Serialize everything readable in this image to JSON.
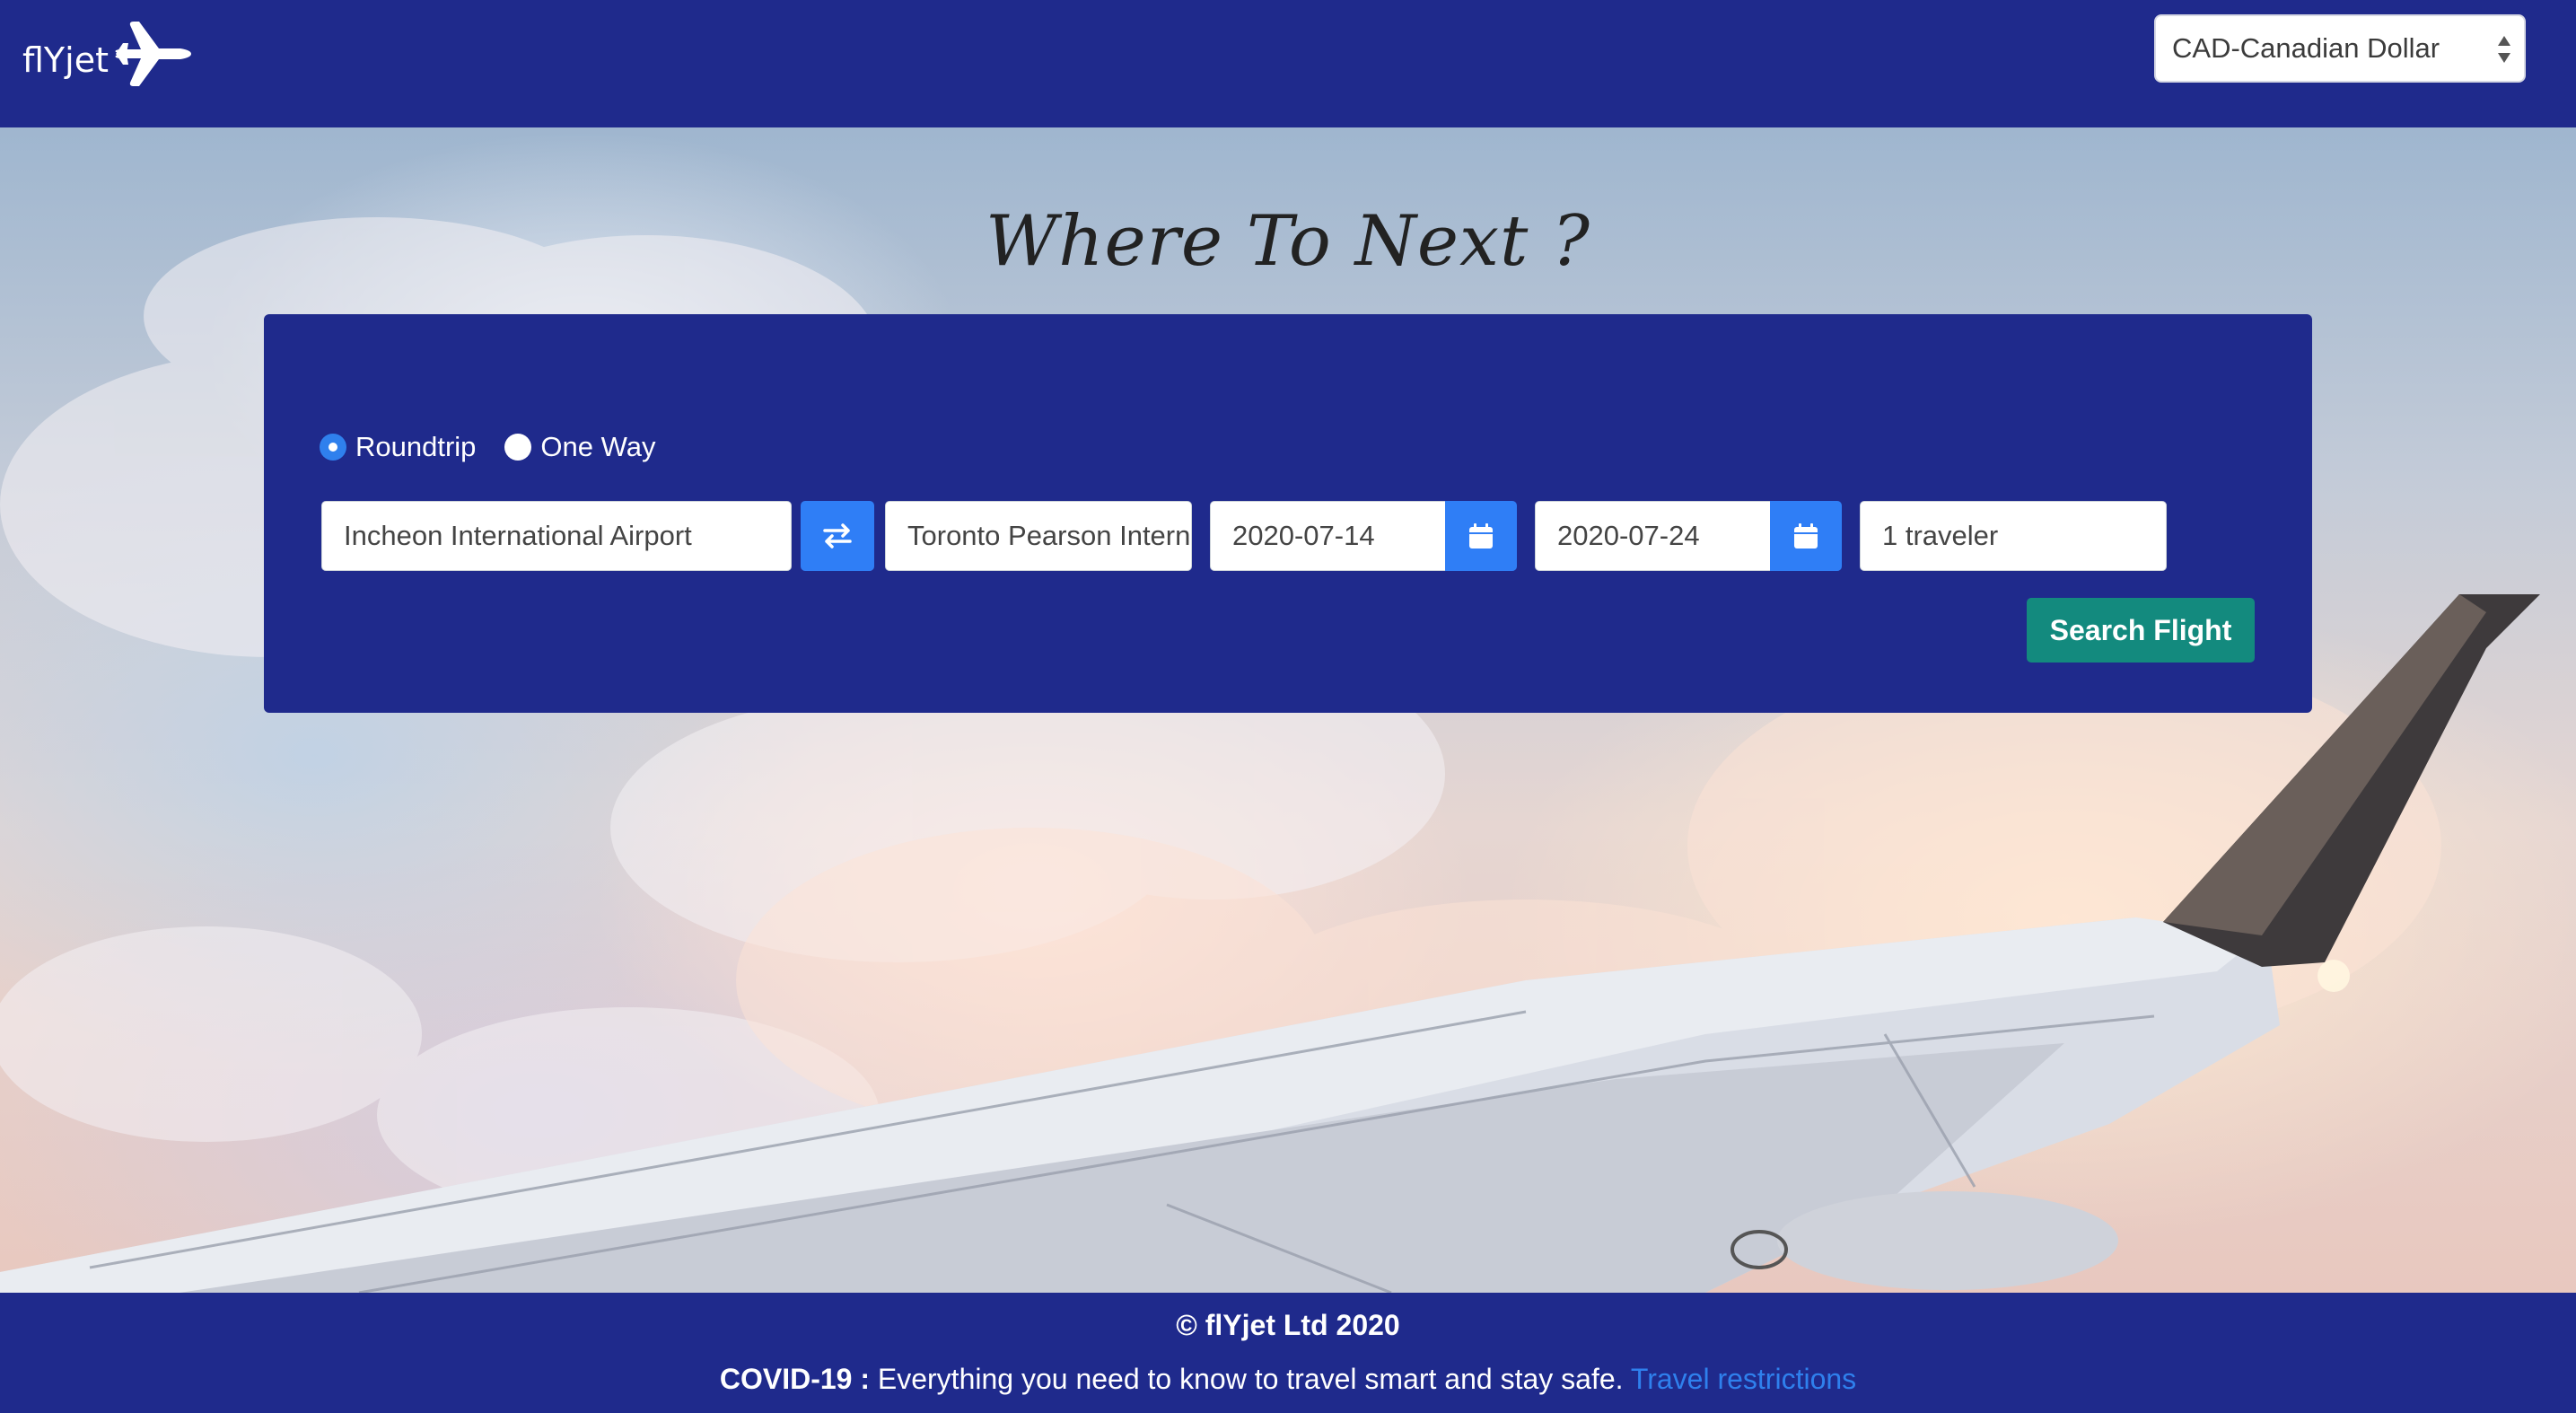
{
  "header": {
    "brand": "flYjet",
    "logo_icon": "airplane-icon",
    "currency": {
      "selected": "CAD-Canadian Dollar",
      "icon": "select-arrows-icon"
    }
  },
  "hero": {
    "title": "Where To Next ?"
  },
  "search": {
    "trip_types": [
      {
        "label": "Roundtrip",
        "checked": true
      },
      {
        "label": "One Way",
        "checked": false
      }
    ],
    "origin": "Incheon International Airport",
    "swap_icon": "swap-arrows-icon",
    "destination": "Toronto Pearson International Airport",
    "depart_date": "2020-07-14",
    "return_date": "2020-07-24",
    "calendar_icon": "calendar-icon",
    "travelers": "1 traveler",
    "submit_label": "Search Flight"
  },
  "footer": {
    "copyright": "© flYjet Ltd 2020",
    "covid_label": "COVID-19 :",
    "covid_text": " Everything you need to know to travel smart and stay safe. ",
    "covid_link": "Travel restrictions"
  },
  "colors": {
    "brand_navy": "#1f2a8c",
    "accent_blue": "#2f7ef6",
    "search_green": "#138a7e",
    "link_blue": "#2f80ed"
  }
}
